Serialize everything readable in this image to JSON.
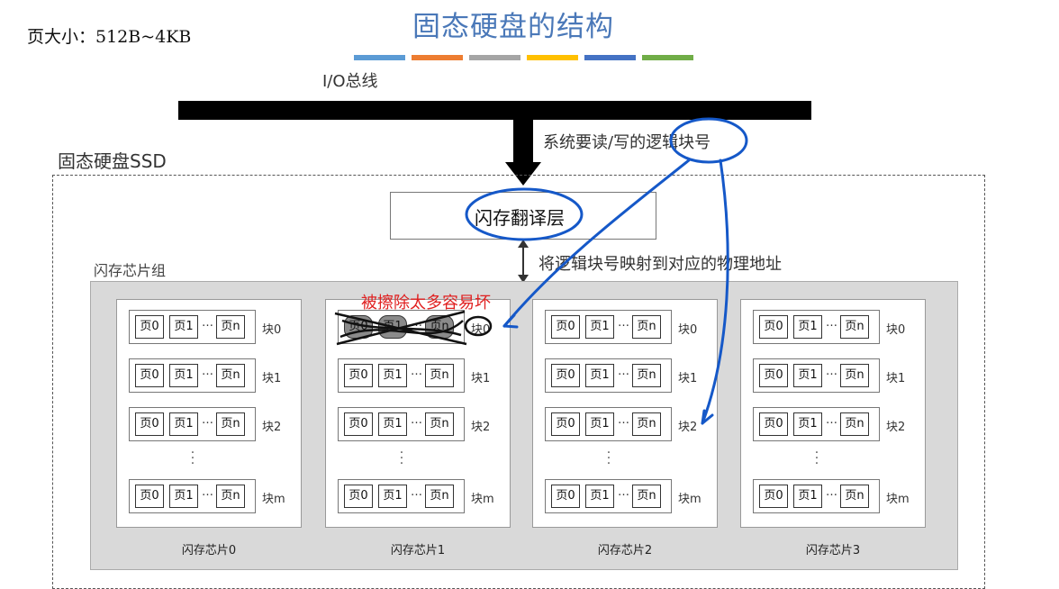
{
  "page_size_note": "页大小：512B~4KB",
  "title": "固态硬盘的结构",
  "color_bar": [
    "#5b9bd5",
    "#ed7d31",
    "#a5a5a5",
    "#ffc000",
    "#4472c4",
    "#70ad47"
  ],
  "io_bus_label": "I/O总线",
  "system_request_label": "系统要读/写的逻辑块号",
  "ssd_label": "固态硬盘SSD",
  "ftl_label": "闪存翻译层",
  "mapping_label": "将逻辑块号映射到对应的物理地址",
  "chip_group_label": "闪存芯片组",
  "annotation": "被擦除太多容易坏",
  "annotation_color": "#e02020",
  "ink_color": "#1558c8",
  "chips": [
    {
      "name": "闪存芯片0",
      "blocks": [
        {
          "label": "块0",
          "pages": [
            "页0",
            "页1",
            "…",
            "页n"
          ]
        },
        {
          "label": "块1",
          "pages": [
            "页0",
            "页1",
            "…",
            "页n"
          ]
        },
        {
          "label": "块2",
          "pages": [
            "页0",
            "页1",
            "…",
            "页n"
          ]
        },
        {
          "label": "块m",
          "pages": [
            "页0",
            "页1",
            "…",
            "页n"
          ]
        }
      ]
    },
    {
      "name": "闪存芯片1",
      "blocks": [
        {
          "label": "块0",
          "pages": [
            "页0",
            "页1",
            "…",
            "页n"
          ]
        },
        {
          "label": "块1",
          "pages": [
            "页0",
            "页1",
            "…",
            "页n"
          ]
        },
        {
          "label": "块2",
          "pages": [
            "页0",
            "页1",
            "…",
            "页n"
          ]
        },
        {
          "label": "块m",
          "pages": [
            "页0",
            "页1",
            "…",
            "页n"
          ]
        }
      ]
    },
    {
      "name": "闪存芯片2",
      "blocks": [
        {
          "label": "块0",
          "pages": [
            "页0",
            "页1",
            "…",
            "页n"
          ]
        },
        {
          "label": "块1",
          "pages": [
            "页0",
            "页1",
            "…",
            "页n"
          ]
        },
        {
          "label": "块2",
          "pages": [
            "页0",
            "页1",
            "…",
            "页n"
          ]
        },
        {
          "label": "块m",
          "pages": [
            "页0",
            "页1",
            "…",
            "页n"
          ]
        }
      ]
    },
    {
      "name": "闪存芯片3",
      "blocks": [
        {
          "label": "块0",
          "pages": [
            "页0",
            "页1",
            "…",
            "页n"
          ]
        },
        {
          "label": "块1",
          "pages": [
            "页0",
            "页1",
            "…",
            "页n"
          ]
        },
        {
          "label": "块2",
          "pages": [
            "页0",
            "页1",
            "…",
            "页n"
          ]
        },
        {
          "label": "块m",
          "pages": [
            "页0",
            "页1",
            "…",
            "页n"
          ]
        }
      ]
    }
  ]
}
